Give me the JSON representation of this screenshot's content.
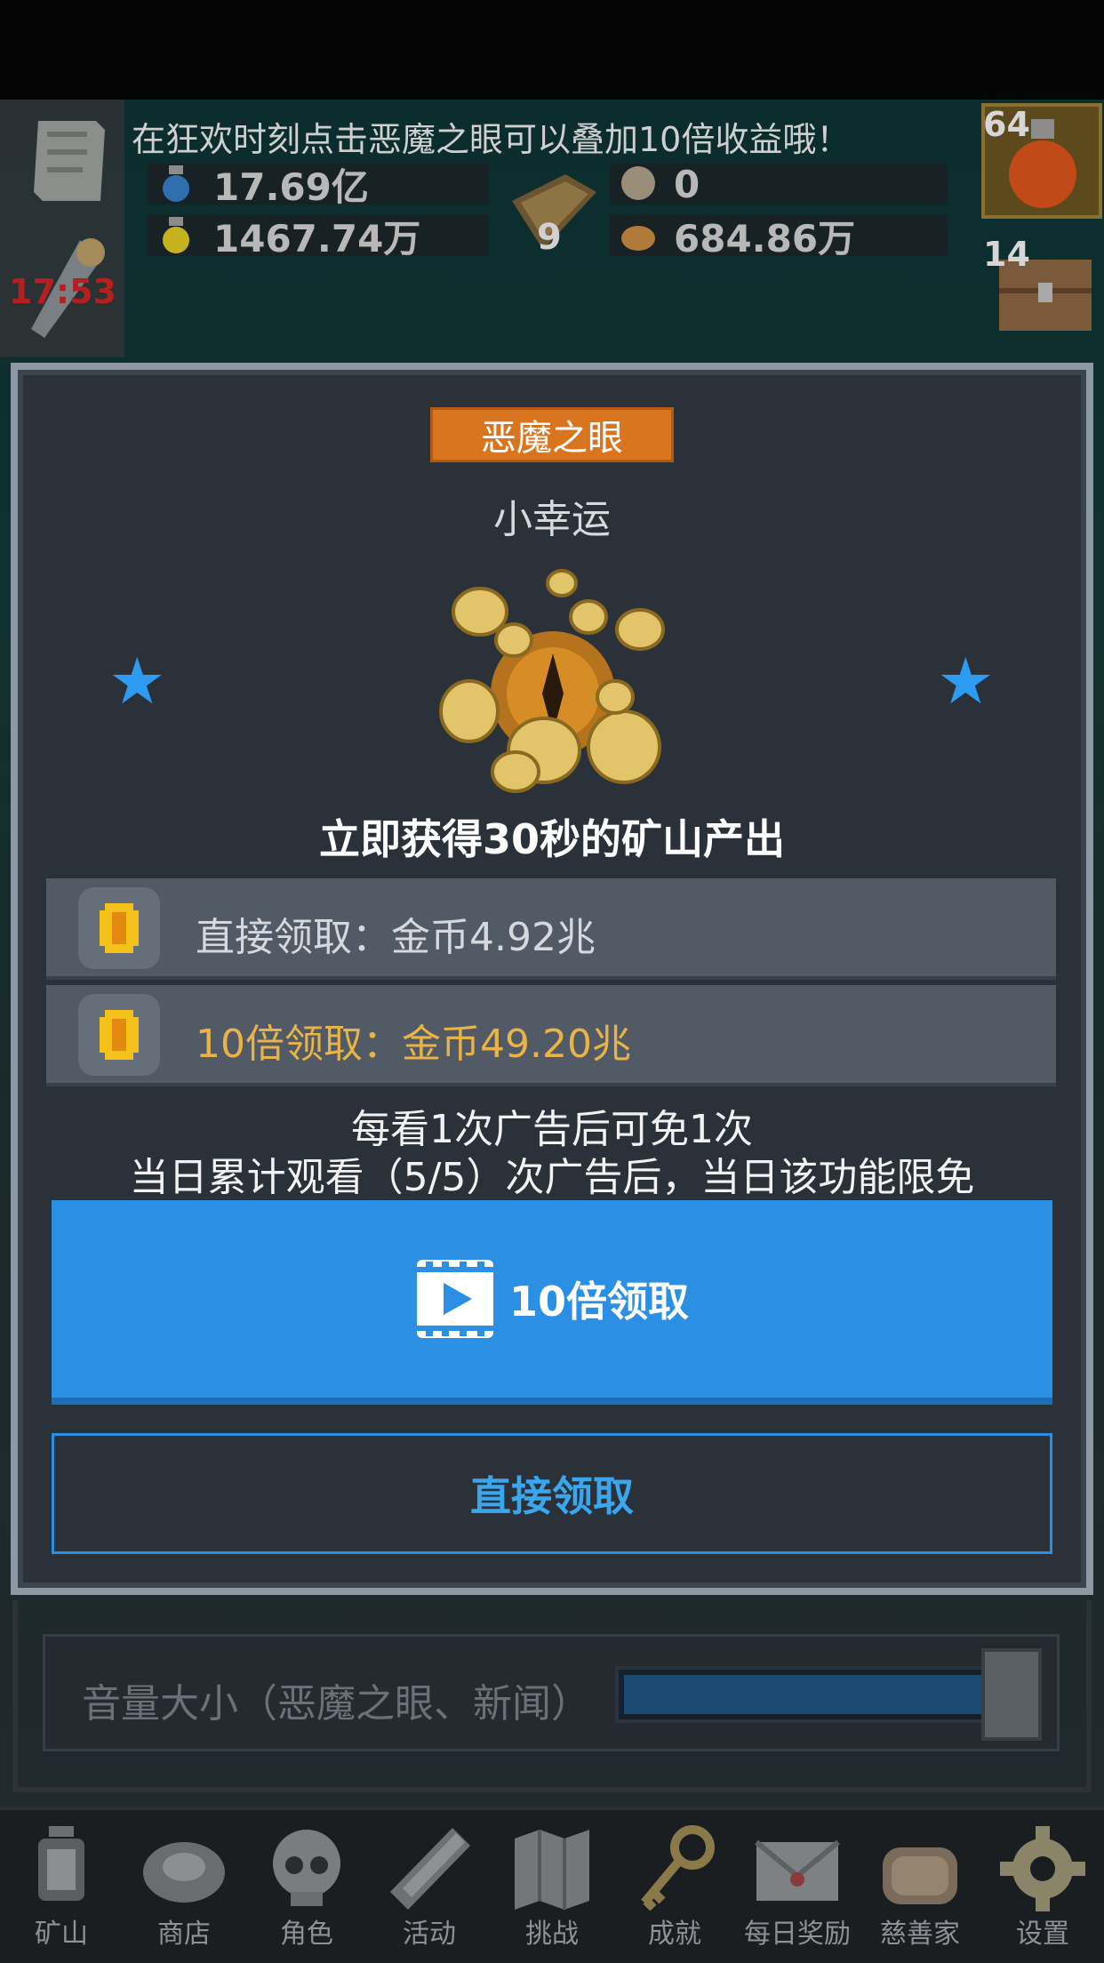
{
  "hud": {
    "marquee": "在狂欢时刻点击恶魔之眼可以叠加10倍收益哦！",
    "timer": "17:53",
    "blue_potion": "17.69亿",
    "yellow_potion": "1467.74万",
    "book_count": "9",
    "skull_count": "0",
    "ore_count": "684.86万",
    "potion_count": "64",
    "chest_count": "14"
  },
  "settings": {
    "volume_label": "音量大小（恶魔之眼、新闻）",
    "volume_level": 0.9
  },
  "modal": {
    "title": "恶魔之眼",
    "subtitle": "小幸运",
    "headline": "立即获得30秒的矿山产出",
    "option_direct": "直接领取：金币4.92兆",
    "option_multi": "10倍领取：金币49.20兆",
    "note_line1": "每看1次广告后可免1次",
    "note_line2": "当日累计观看（5/5）次广告后，当日该功能限免",
    "primary_button": "10倍领取",
    "secondary_button": "直接领取"
  },
  "nav": [
    {
      "label": "矿山",
      "icon": "lantern-icon"
    },
    {
      "label": "商店",
      "icon": "shop-icon"
    },
    {
      "label": "角色",
      "icon": "skull-icon"
    },
    {
      "label": "活动",
      "icon": "scroll-icon"
    },
    {
      "label": "挑战",
      "icon": "map-icon"
    },
    {
      "label": "成就",
      "icon": "key-icon"
    },
    {
      "label": "每日奖励",
      "icon": "envelope-icon"
    },
    {
      "label": "慈善家",
      "icon": "bread-icon"
    },
    {
      "label": "设置",
      "icon": "gear-icon"
    }
  ],
  "colors": {
    "accent_blue": "#2b8fe3",
    "title_orange": "#d9741f",
    "gold_text": "#e8b347",
    "modal_bg": "#2b3139"
  }
}
